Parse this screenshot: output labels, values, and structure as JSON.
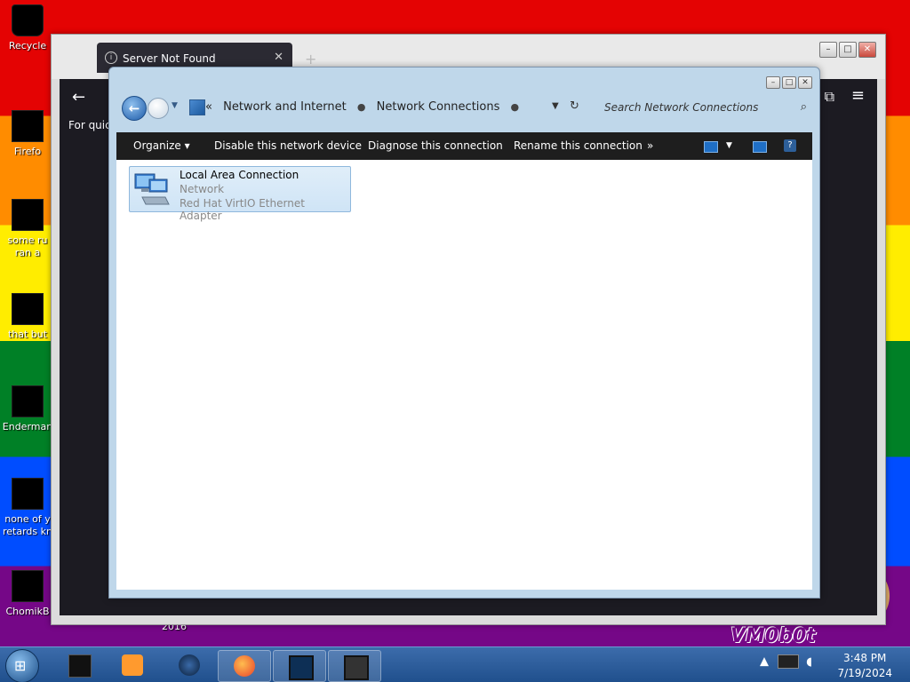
{
  "desktop": {
    "icons": [
      {
        "label1": "Recycle",
        "label2": ""
      },
      {
        "label1": "Firefo",
        "label2": ""
      },
      {
        "label1": "some ru",
        "label2": "ran a"
      },
      {
        "label1": "that but",
        "label2": ""
      },
      {
        "label1": "Enderman",
        "label2": ""
      },
      {
        "label1": "none of y",
        "label2": "retards kn"
      },
      {
        "label1": "ChomikB",
        "label2": ""
      }
    ],
    "year_label": "2016",
    "watermark": "VM0b0t"
  },
  "browser": {
    "tab_title": "Server Not Found",
    "tab_close": "✕",
    "new_tab": "+",
    "back_arrow": "←",
    "quick_text": "For quick",
    "menu_glyph": "≡",
    "ext_glyph": "⧉",
    "win_min": "–",
    "win_max": "□",
    "win_close": "✕"
  },
  "explorer": {
    "breadcrumb": {
      "lead": "«",
      "items": [
        "Network and Internet",
        "Network Connections"
      ]
    },
    "search_placeholder": "Search Network Connections",
    "commands": [
      "Organize ▾",
      "Disable this network device",
      "Diagnose this connection",
      "Rename this connection",
      "»"
    ],
    "connection": {
      "name": "Local Area Connection",
      "status": "Network",
      "device": "Red Hat VirtIO Ethernet Adapter"
    },
    "win_min": "–",
    "win_max": "□",
    "win_close": "✕"
  },
  "taskbar": {
    "time": "3:48 PM",
    "date": "7/19/2024",
    "buttons": [
      "terminal-app",
      "media-player",
      "globe-app",
      "firefox",
      "remote-desktop",
      "network-connections"
    ]
  },
  "icons": {
    "back": "back-arrow-icon",
    "forward": "forward-arrow-icon",
    "refresh": "refresh-icon",
    "search": "search-icon"
  }
}
